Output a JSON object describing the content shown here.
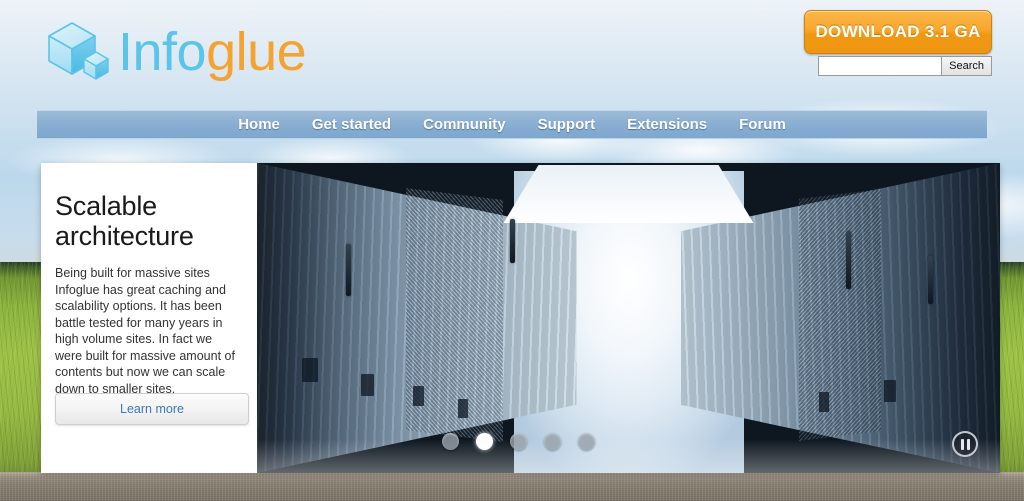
{
  "site": {
    "logo_text_part1": "Info",
    "logo_text_part2": "glue",
    "logo_icon": "cube-logo-icon"
  },
  "header": {
    "download_label": "DOWNLOAD 3.1 GA",
    "search": {
      "value": "",
      "placeholder": "",
      "button_label": "Search"
    }
  },
  "nav": {
    "items": [
      {
        "label": "Home"
      },
      {
        "label": "Get started"
      },
      {
        "label": "Community"
      },
      {
        "label": "Support"
      },
      {
        "label": "Extensions"
      },
      {
        "label": "Forum"
      }
    ]
  },
  "carousel": {
    "slide": {
      "title": "Scalable architecture",
      "body": "Being built for massive sites Infoglue has great caching and scalability options. It has been battle tested for many years in high volume sites. In fact we were built for massive amount of contents but now we can scale down to smaller sites.",
      "cta_label": "Learn more",
      "image_description": "data-center-corridor-photo"
    },
    "dots": [
      {
        "active": false
      },
      {
        "active": true
      },
      {
        "active": false
      },
      {
        "active": false
      },
      {
        "active": false
      }
    ],
    "pause_icon": "pause-icon"
  },
  "colors": {
    "accent_orange": "#f0980f",
    "logo_blue": "#5bc4e8",
    "logo_orange": "#f5a330",
    "nav_blue": "#89aed2",
    "link_blue": "#3c78c0"
  }
}
